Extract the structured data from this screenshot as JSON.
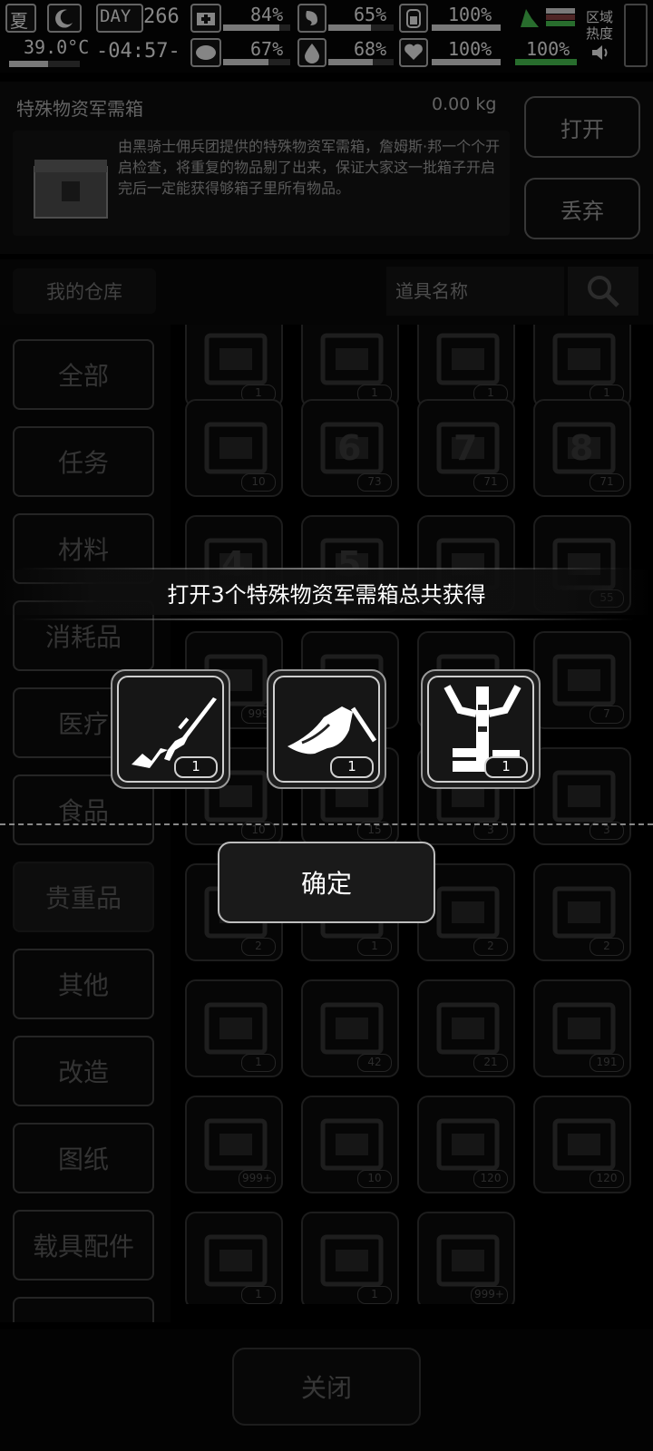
{
  "status": {
    "season": "夏",
    "day_label": "DAY",
    "day": "266",
    "temperature": "39.0°C",
    "clock": "-04:57-",
    "stat1": "84%",
    "stat2": "67%",
    "stat3": "65%",
    "stat4": "68%",
    "stat5": "100%",
    "stat6": "100%",
    "stat7": "100%",
    "zone_label": "区域热度",
    "levels": {
      "stat1": 0.84,
      "stat2": 0.67,
      "stat3": 0.65,
      "stat4": 0.68,
      "stat5": 1.0,
      "stat6": 1.0,
      "stat7": 1.0
    }
  },
  "item_panel": {
    "name": "特殊物资军需箱",
    "weight": "0.00 kg",
    "description": "由黑骑士佣兵团提供的特殊物资军需箱，詹姆斯·邦一个个开启检查，将重复的物品剔了出来，保证大家这一批箱子开启完后一定能获得够箱子里所有物品。",
    "open_label": "打开",
    "discard_label": "丢弃"
  },
  "warehouse": {
    "title": "我的仓库",
    "search_placeholder": "道具名称"
  },
  "tabs": [
    "全部",
    "任务",
    "材料",
    "消耗品",
    "医疗",
    "食品",
    "贵重品",
    "其他",
    "改造",
    "图纸",
    "载具配件"
  ],
  "grid": {
    "counts": [
      "1",
      "1",
      "1",
      "1",
      "10",
      "73",
      "71",
      "71",
      "",
      "",
      "",
      "55",
      "999",
      "",
      "",
      "7",
      "10",
      "15",
      "3",
      "3",
      "2",
      "1",
      "2",
      "2",
      "1",
      "42",
      "21",
      "191",
      "999+",
      "10",
      "120",
      "120",
      "1",
      "1",
      "999+"
    ],
    "level_labels": [
      "6",
      "7",
      "8",
      "4",
      "5"
    ]
  },
  "modal": {
    "title": "打开3个特殊物资军需箱总共获得",
    "rewards": [
      {
        "icon": "rifle-icon",
        "count": "1"
      },
      {
        "icon": "chainsaw-icon",
        "count": "1"
      },
      {
        "icon": "robot-arm-icon",
        "count": "1"
      }
    ],
    "confirm_label": "确定"
  },
  "footer": {
    "close_label": "关闭"
  },
  "colors": {
    "accent_green": "#3ea845",
    "modal_border": "#bdbdbd"
  }
}
